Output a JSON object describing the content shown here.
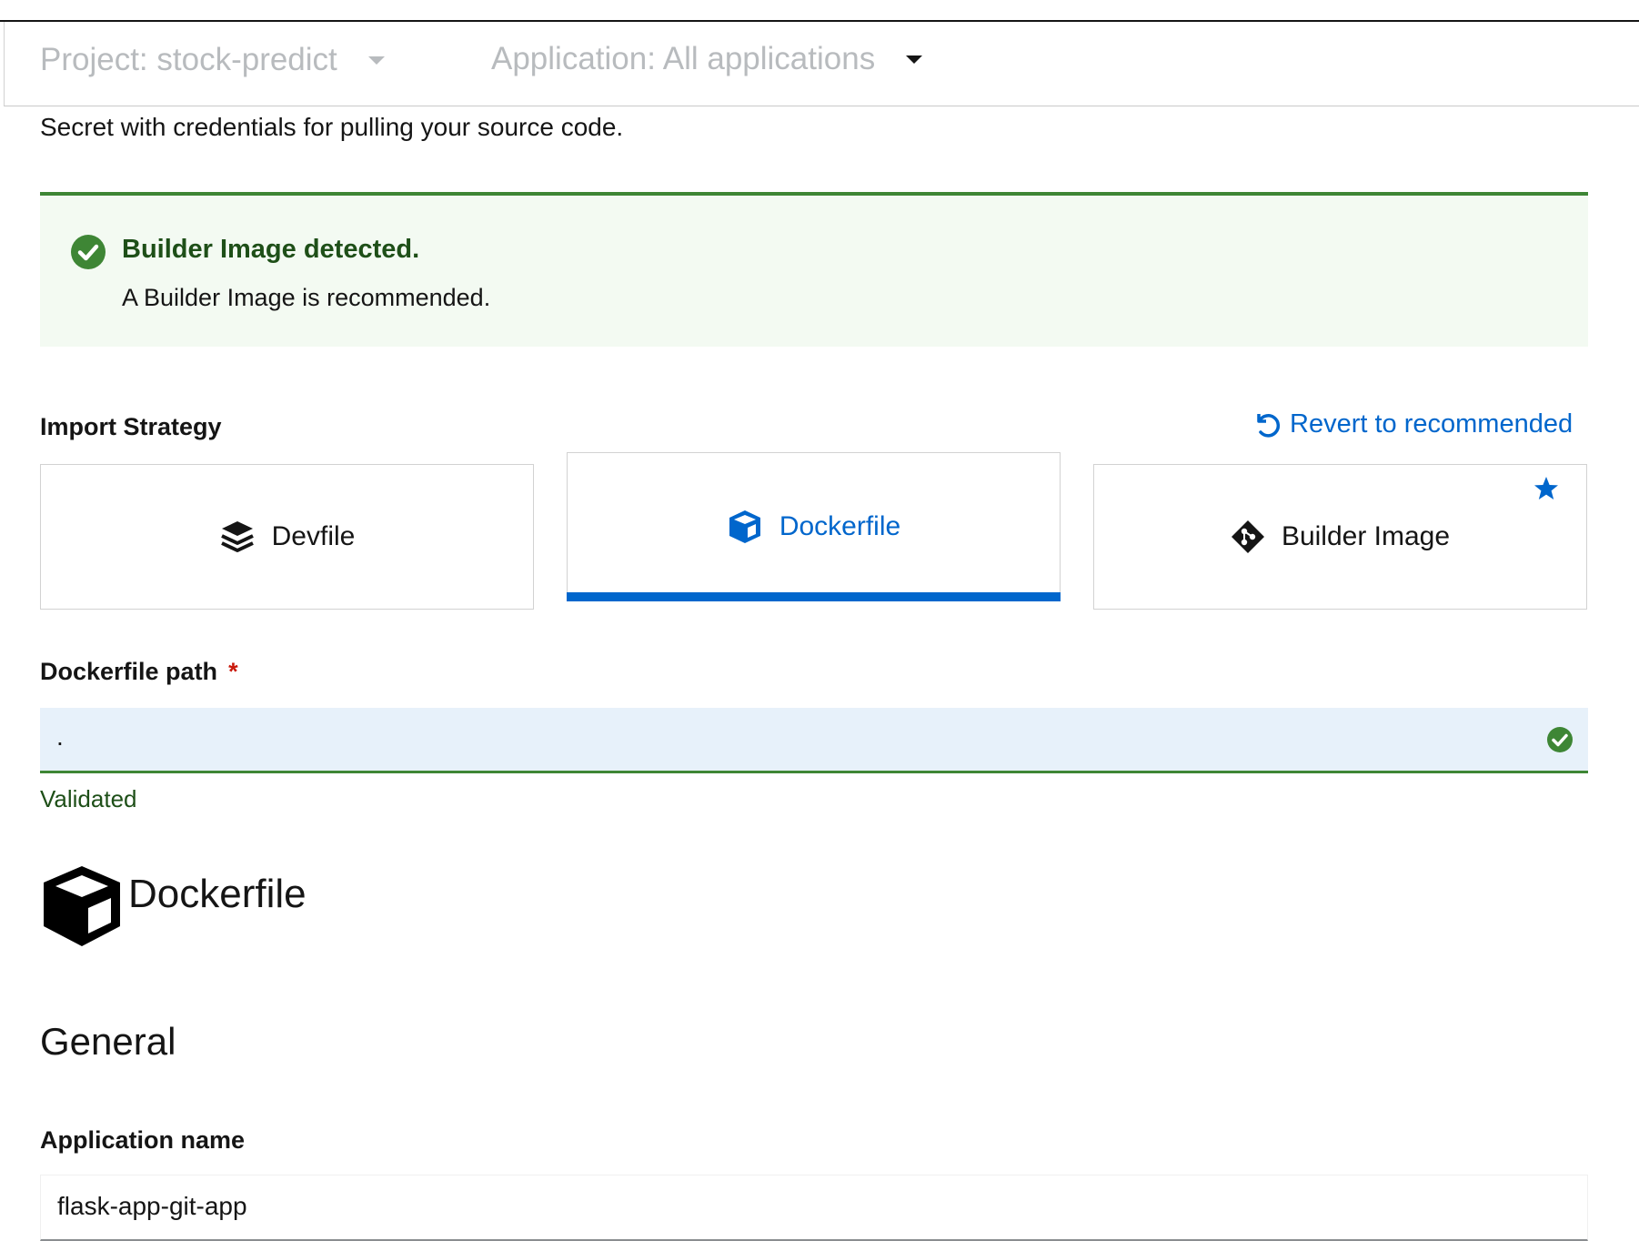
{
  "context_bar": {
    "project_label": "Project: stock-predict",
    "application_label": "Application: All applications"
  },
  "git": {
    "secret_help": "Secret with credentials for pulling your source code."
  },
  "alert": {
    "title": "Builder Image detected.",
    "description": "A Builder Image is recommended.",
    "status_color": "#3e8635"
  },
  "import_strategy": {
    "label": "Import Strategy",
    "revert_label": "Revert to recommended",
    "options": [
      {
        "label": "Devfile",
        "icon": "layers-icon",
        "selected": false
      },
      {
        "label": "Dockerfile",
        "icon": "cube-icon",
        "selected": true
      },
      {
        "label": "Builder Image",
        "icon": "git-icon",
        "selected": false,
        "recommended": true
      }
    ],
    "accent_color": "#0066cc"
  },
  "dockerfile_path": {
    "label": "Dockerfile path",
    "required_marker": "*",
    "value": ".",
    "helper": "Validated"
  },
  "dockerfile_section": {
    "title": "Dockerfile",
    "icon": "docker-cube-icon"
  },
  "general": {
    "heading": "General",
    "application_name_label": "Application name",
    "application_name_value": "flask-app-git-app"
  }
}
